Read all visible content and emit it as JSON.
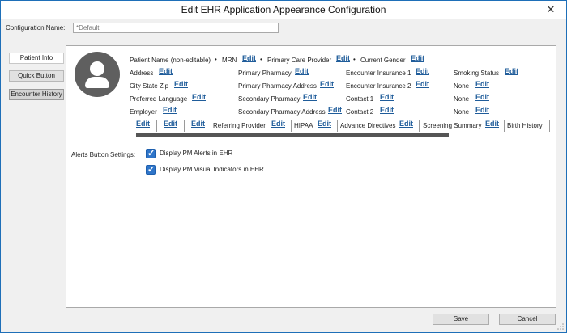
{
  "window": {
    "title": "Edit EHR Application Appearance Configuration",
    "close_glyph": "✕"
  },
  "config": {
    "label": "Configuration Name:",
    "value": "*Default"
  },
  "tabs": [
    {
      "label": "Patient Info"
    },
    {
      "label": "Quick Button"
    },
    {
      "label": "Encounter History"
    }
  ],
  "edit_label": "Edit",
  "fields": {
    "patient_name": "Patient Name (non-editable)",
    "mrn": "MRN",
    "primary_care_provider": "Primary Care Provider",
    "current_gender": "Current Gender",
    "address": "Address",
    "primary_pharmacy": "Primary Pharmacy",
    "encounter_insurance_1": "Encounter Insurance 1",
    "smoking_status": "Smoking Status",
    "city_state_zip": "City State Zip",
    "primary_pharmacy_address": "Primary Pharmacy Address",
    "encounter_insurance_2": "Encounter Insurance 2",
    "none_1": "None",
    "preferred_language": "Preferred Language",
    "secondary_pharmacy": "Secondary Pharmacy",
    "contact_1": "Contact 1",
    "none_2": "None",
    "employer": "Employer",
    "secondary_pharmacy_address": "Secondary Pharmacy Address",
    "contact_2": "Contact 2",
    "none_3": "None"
  },
  "scroll_row": {
    "referring_provider": "Referring Provider",
    "hipaa": "HIPAA",
    "advance_directives": "Advance Directives",
    "screening_summary": "Screening Summary",
    "birth_history": "Birth History"
  },
  "bullet": "•",
  "alerts": {
    "label": "Alerts Button Settings:",
    "options": [
      {
        "label": "Display PM Alerts in EHR",
        "checked": true
      },
      {
        "label": "Display PM Visual Indicators in EHR",
        "checked": true
      }
    ]
  },
  "footer": {
    "save": "Save",
    "cancel": "Cancel"
  },
  "colors": {
    "accent": "#2f75c9",
    "link": "#1f5c9a",
    "window_border": "#1e6fb8"
  },
  "icons": {
    "avatar": "user-avatar-icon",
    "close": "close-icon",
    "checkbox": "checkmark-icon"
  }
}
